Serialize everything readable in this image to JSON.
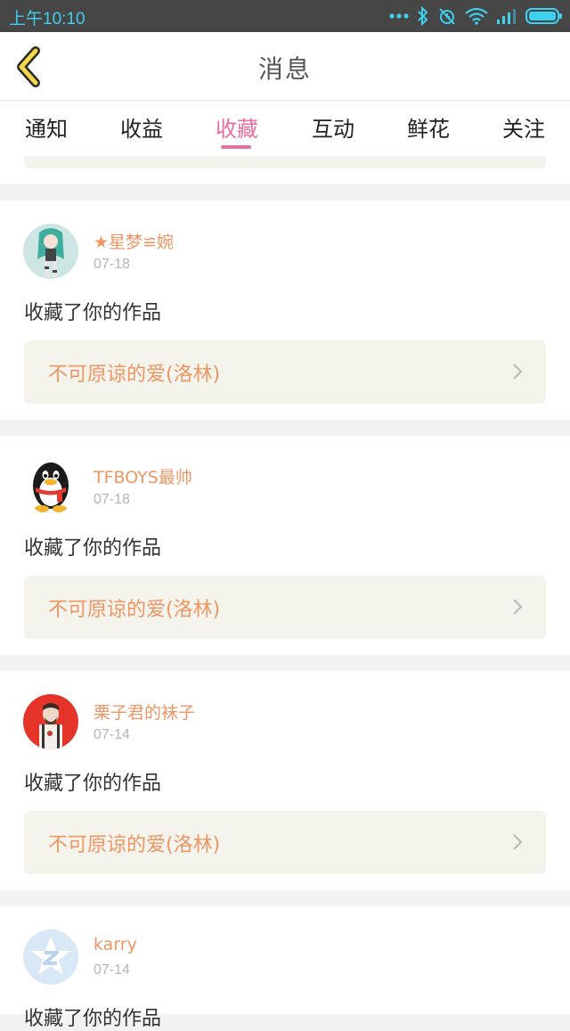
{
  "status_bar": {
    "time": "上午10:10",
    "icons": [
      "dots-icon",
      "bluetooth-icon",
      "alarm-off-icon",
      "wifi-icon",
      "signal-icon",
      "battery-icon"
    ]
  },
  "header": {
    "title": "消息",
    "back_icon": "chevron-left-icon"
  },
  "tabs": [
    {
      "label": "通知",
      "active": false
    },
    {
      "label": "收益",
      "active": false
    },
    {
      "label": "收藏",
      "active": true
    },
    {
      "label": "互动",
      "active": false
    },
    {
      "label": "鲜花",
      "active": false
    },
    {
      "label": "关注",
      "active": false
    }
  ],
  "colors": {
    "accent": "#e86ea1",
    "username": "#ef9665",
    "status_bar_bg": "#464646",
    "status_time": "#3fd0ee",
    "work_box_bg": "#f4f3ec"
  },
  "messages": [
    {
      "username": "★星梦≌婉",
      "date": "07-18",
      "action": "收藏了你的作品",
      "work": "不可原谅的爱(洛林)"
    },
    {
      "username": "TFBOYS最帅",
      "date": "07-18",
      "action": "收藏了你的作品",
      "work": "不可原谅的爱(洛林)"
    },
    {
      "username": "栗子君的袜子",
      "date": "07-14",
      "action": "收藏了你的作品",
      "work": "不可原谅的爱(洛林)"
    },
    {
      "username": "karry",
      "date": "07-14",
      "action": "收藏了你的作品",
      "work": ""
    }
  ]
}
